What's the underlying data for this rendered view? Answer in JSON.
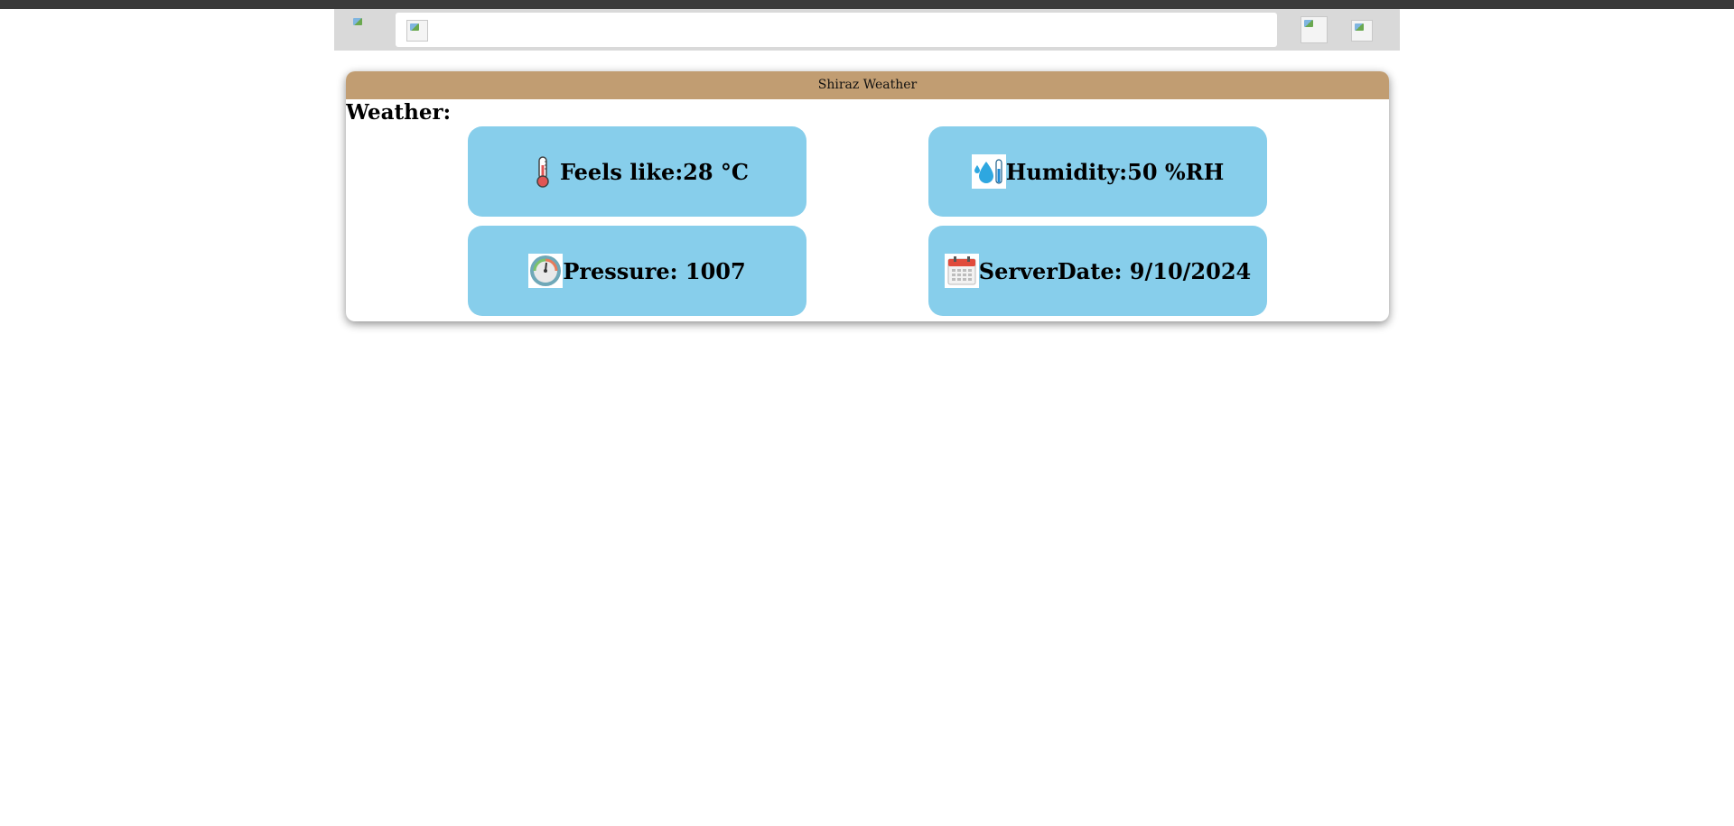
{
  "header": {
    "card_title": "Shiraz Weather"
  },
  "weather": {
    "section_title": "Weather:",
    "tiles": [
      {
        "icon": "thermometer-icon",
        "text": "Feels like:28 °C"
      },
      {
        "icon": "humidity-icon",
        "text": "Humidity:50 %RH"
      },
      {
        "icon": "pressure-gauge-icon",
        "text": "Pressure: 1007"
      },
      {
        "icon": "calendar-icon",
        "text": "ServerDate: 9/10/2024"
      }
    ]
  },
  "colors": {
    "header_bar": "#c19d72",
    "tile_bg": "#87ceeb",
    "navbar_bg": "#d9d9d9"
  }
}
